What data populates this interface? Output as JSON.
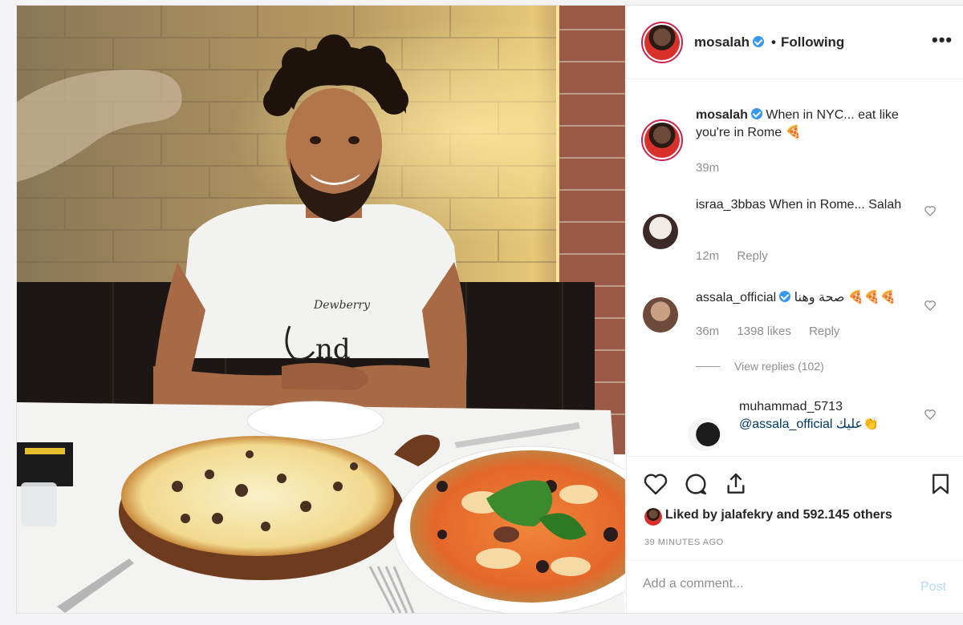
{
  "header": {
    "username": "mosalah",
    "separator": "•",
    "follow_status": "Following",
    "more_label": "•••"
  },
  "caption": {
    "username": "mosalah",
    "text": "When in NYC... eat like you're in Rome 🍕",
    "time": "39m"
  },
  "comments": [
    {
      "username": "israa_3bbas",
      "text": "When in Rome... Salah",
      "time": "12m",
      "likes": "",
      "reply_label": "Reply"
    },
    {
      "username": "assala_official",
      "text": "صحة وهنا 🍕🍕🍕",
      "time": "36m",
      "likes": "1398 likes",
      "reply_label": "Reply",
      "view_replies": "View replies (102)"
    }
  ],
  "reply": {
    "username": "muhammad_5713",
    "text": "@assala_official عليك👏"
  },
  "actions": {
    "liked_by": "Liked by jalafekry and 592.145 others",
    "time_ago": "39 MINUTES AGO"
  },
  "add_comment": {
    "placeholder": "Add a comment...",
    "post_label": "Post"
  },
  "colors": {
    "accent": "#3897f0",
    "ring": "#c7254e",
    "post_disabled": "#b3dbff"
  }
}
